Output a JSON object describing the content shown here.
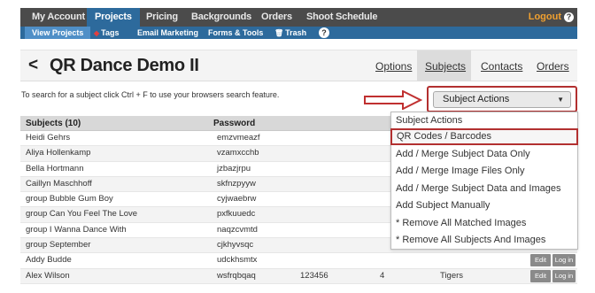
{
  "topnav": {
    "tabs": [
      "My Account",
      "Projects",
      "Pricing",
      "Backgrounds",
      "Orders",
      "Shoot Schedule"
    ],
    "logout": "Logout",
    "help": "?"
  },
  "subnav": {
    "items": [
      "View Projects",
      "Tags",
      "Email Marketing",
      "Forms & Tools",
      "Trash"
    ],
    "help": "?"
  },
  "header": {
    "back": "<",
    "title": "QR Dance Demo II",
    "links": [
      "Options",
      "Subjects",
      "Contacts",
      "Orders"
    ]
  },
  "hint": "To search for a subject click Ctrl + F to use your browsers search feature.",
  "actions_select": {
    "selected": "Subject Actions",
    "caret": "▼"
  },
  "table": {
    "headers": [
      "Subjects (10)",
      "Password"
    ],
    "rows": [
      {
        "name": "Heidi Gehrs",
        "password": "emzvmeazf"
      },
      {
        "name": "Aliya Hollenkamp",
        "password": "vzamxcchb"
      },
      {
        "name": "Bella Hortmann",
        "password": "jzbazjrpu"
      },
      {
        "name": "Caillyn Maschhoff",
        "password": "skfnzpyyw"
      },
      {
        "name": "group Bubble Gum Boy",
        "password": "cyjwaebrw"
      },
      {
        "name": "group Can You Feel The Love",
        "password": "pxfkuuedc"
      },
      {
        "name": "group I Wanna Dance With",
        "password": "naqzcvmtd"
      },
      {
        "name": "group September",
        "password": "cjkhyvsqc"
      },
      {
        "name": "Addy Budde",
        "password": "udckhsmtx",
        "edit": "Edit",
        "login": "Log in"
      },
      {
        "name": "Alex Wilson",
        "password": "wsfrqbqaq",
        "number": "123456",
        "count": "4",
        "team": "Tigers",
        "edit": "Edit",
        "login": "Log in"
      }
    ]
  },
  "dropdown": {
    "items": [
      "Subject Actions",
      "QR Codes / Barcodes",
      "Add / Merge Subject Data Only",
      "Add / Merge Image Files Only",
      "Add / Merge Subject Data and Images",
      "Add Subject Manually",
      "* Remove All Matched Images",
      "* Remove All Subjects And Images"
    ]
  },
  "colors": {
    "nav_dark": "#4b4b4b",
    "nav_blue": "#2d6a9c",
    "accent_red": "#b23030",
    "logout_orange": "#f0a030"
  }
}
